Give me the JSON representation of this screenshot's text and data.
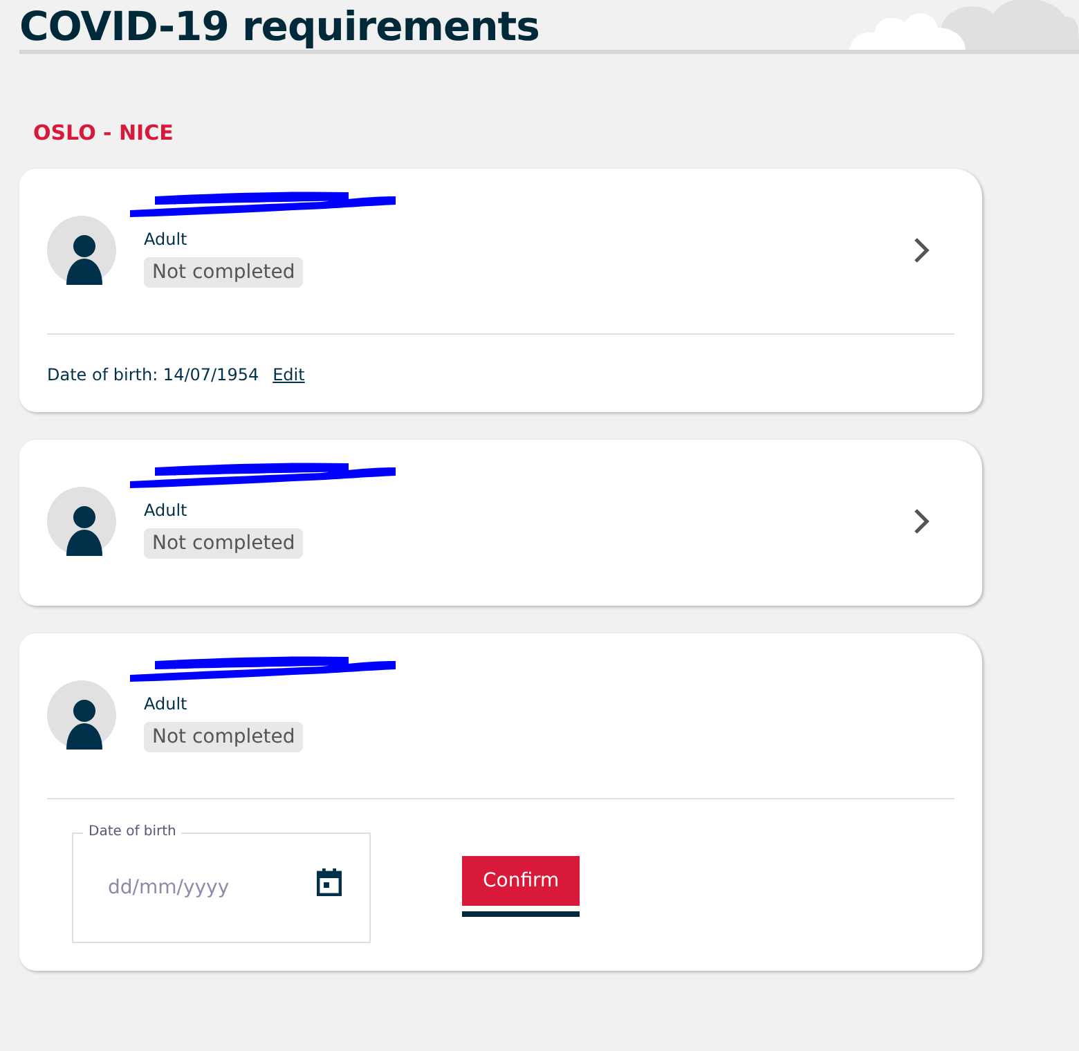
{
  "page_title": "COVID-19 requirements",
  "route": "OSLO - NICE",
  "passengers": [
    {
      "name_redacted": true,
      "type": "Adult",
      "status": "Not completed",
      "has_chevron": true,
      "footer": {
        "kind": "dob",
        "label": "Date of birth: 14/07/1954",
        "link": "Edit"
      }
    },
    {
      "name_redacted": true,
      "type": "Adult",
      "status": "Not completed",
      "has_chevron": true
    },
    {
      "name_redacted": true,
      "type": "Adult",
      "status": "Not completed",
      "has_chevron": false,
      "footer": {
        "kind": "form",
        "field_label": "Date of birth",
        "placeholder": "dd/mm/yyyy",
        "button": "Confirm"
      }
    }
  ]
}
